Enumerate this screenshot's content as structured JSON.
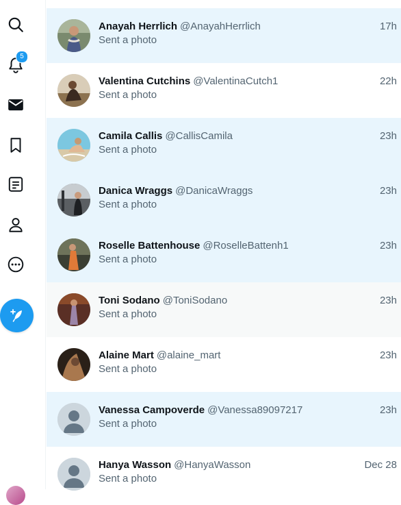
{
  "sidebar": {
    "icons": [
      "search-icon",
      "bell-icon",
      "envelope-icon",
      "bookmark-icon",
      "list-icon",
      "person-icon",
      "more-icon"
    ],
    "notification_count": "5",
    "compose_icon": "compose-tweet-icon"
  },
  "conversations": [
    {
      "name": "Anayah Herrlich",
      "handle": "@AnayahHerrlich",
      "time": "17h",
      "preview": "Sent a photo",
      "state": "unread"
    },
    {
      "name": "Valentina Cutchins",
      "handle": "@ValentinaCutch1",
      "time": "22h",
      "preview": "Sent a photo",
      "state": "read"
    },
    {
      "name": "Camila Callis",
      "handle": "@CallisCamila",
      "time": "23h",
      "preview": "Sent a photo",
      "state": "unread"
    },
    {
      "name": "Danica Wraggs",
      "handle": "@DanicaWraggs",
      "time": "23h",
      "preview": "Sent a photo",
      "state": "unread"
    },
    {
      "name": "Roselle Battenhouse",
      "handle": "@RoselleBattenh1",
      "time": "23h",
      "preview": "Sent a photo",
      "state": "unread"
    },
    {
      "name": "Toni Sodano",
      "handle": "@ToniSodano",
      "time": "23h",
      "preview": "Sent a photo",
      "state": "hover"
    },
    {
      "name": "Alaine Mart",
      "handle": "@alaine_mart",
      "time": "23h",
      "preview": "Sent a photo",
      "state": "read"
    },
    {
      "name": "Vanessa Campoverde",
      "handle": "@Vanessa89097217",
      "time": "23h",
      "preview": "Sent a photo",
      "state": "unread"
    },
    {
      "name": "Hanya Wasson",
      "handle": "@HanyaWasson",
      "time": "Dec 28",
      "preview": "Sent a photo",
      "state": "read"
    }
  ],
  "colors": {
    "accent": "#1d9bf0",
    "unread_bg": "#e8f5fd",
    "hover_bg": "#f7f9f9",
    "text_primary": "#0f1419",
    "text_secondary": "#536471"
  }
}
